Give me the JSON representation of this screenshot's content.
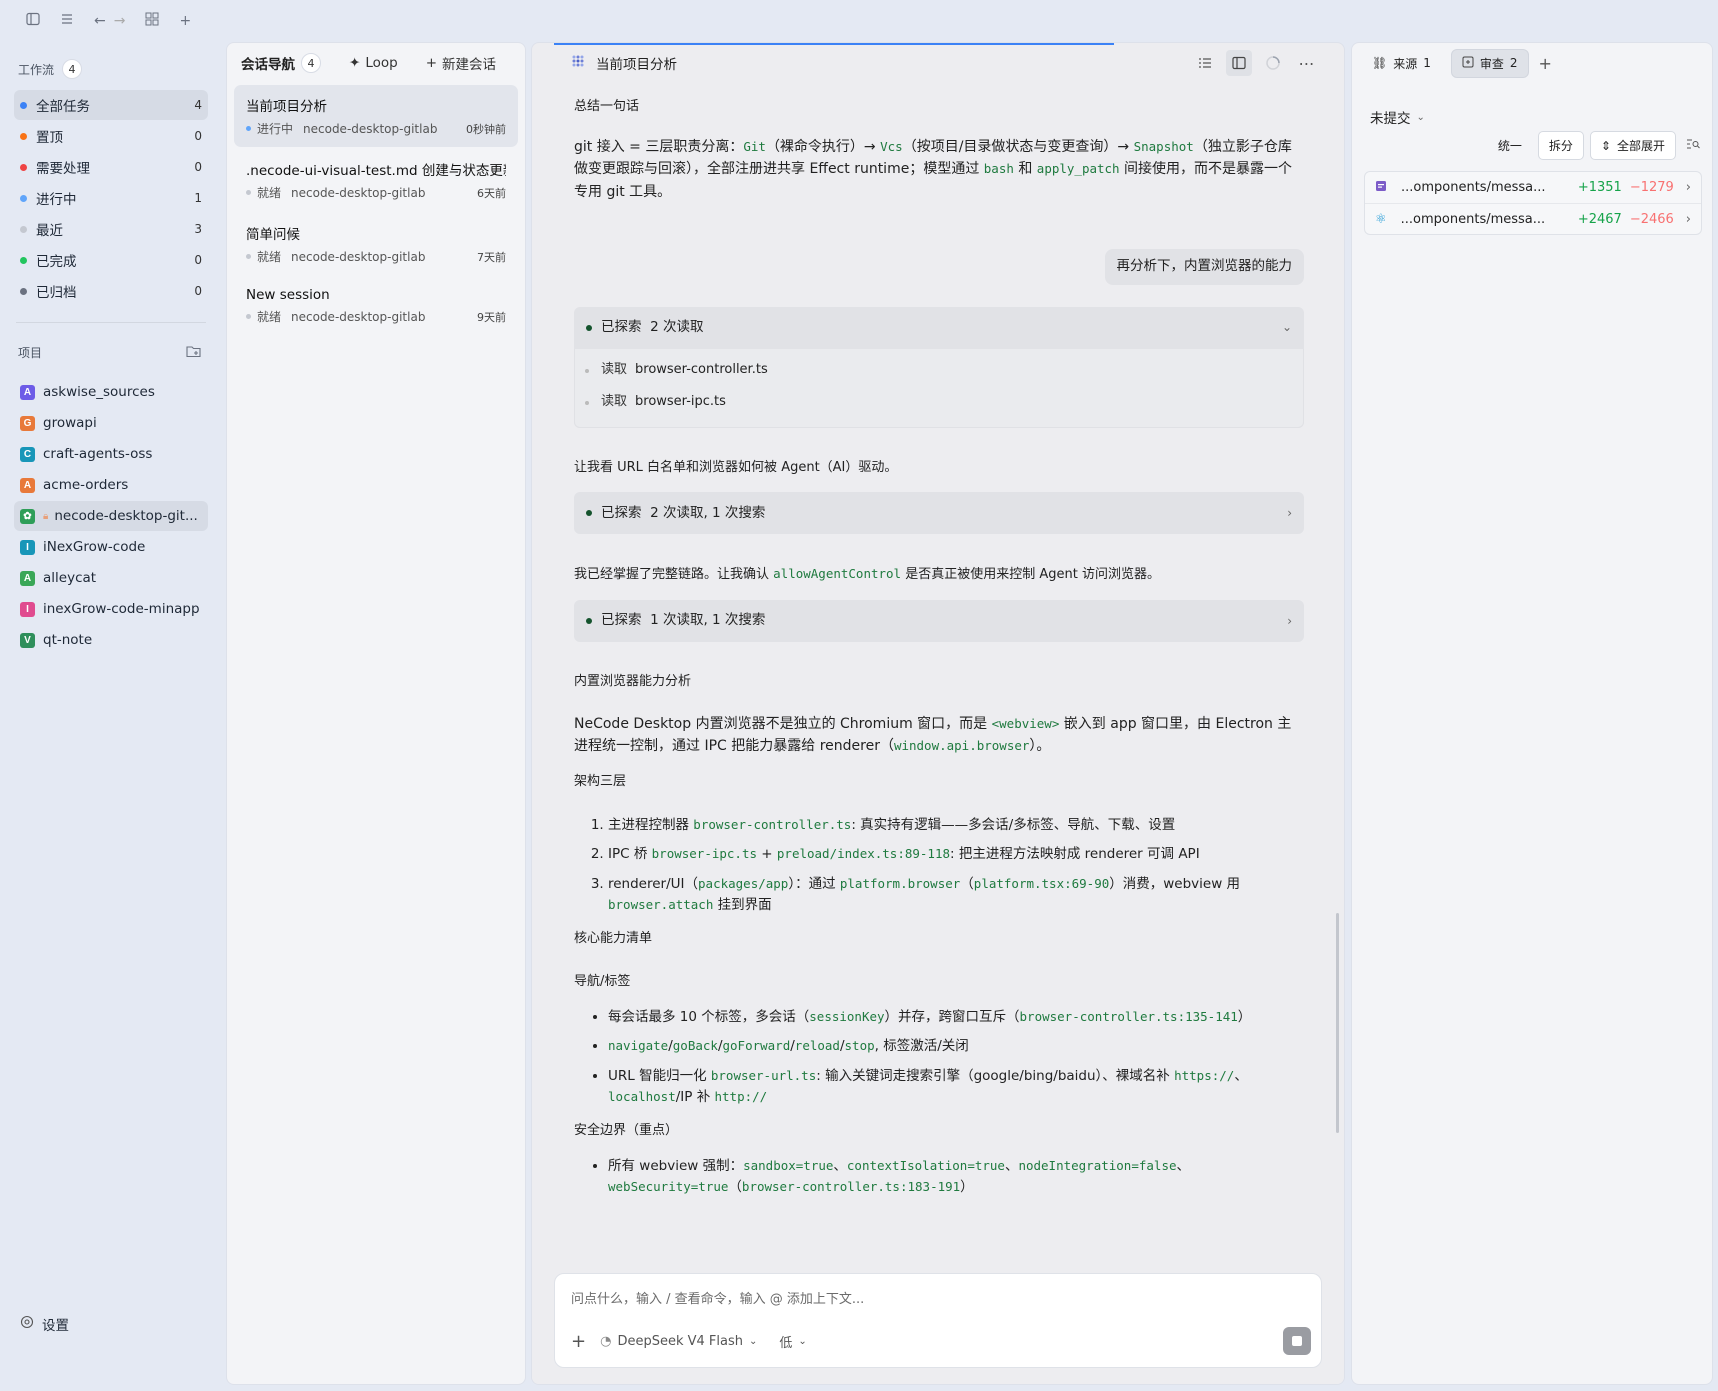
{
  "workflow": {
    "title": "工作流",
    "count": "4",
    "items": [
      {
        "label": "全部任务",
        "count": "4",
        "color": "#3b82f6"
      },
      {
        "label": "置顶",
        "count": "0",
        "color": "#f97316"
      },
      {
        "label": "需要处理",
        "count": "0",
        "color": "#ef4444"
      },
      {
        "label": "进行中",
        "count": "1",
        "color": "#60a5fa"
      },
      {
        "label": "最近",
        "count": "3",
        "color": "#c4c8d0"
      },
      {
        "label": "已完成",
        "count": "0",
        "color": "#22c55e"
      },
      {
        "label": "已归档",
        "count": "0",
        "color": "#6b7280"
      }
    ]
  },
  "projects": {
    "title": "项目",
    "items": [
      {
        "letter": "A",
        "label": "askwise_sources",
        "color": "#6d5ce7"
      },
      {
        "letter": "G",
        "label": "growapi",
        "color": "#e8793a"
      },
      {
        "letter": "C",
        "label": "craft-agents-oss",
        "color": "#1896b8"
      },
      {
        "letter": "A",
        "label": "acme-orders",
        "color": "#e8793a"
      },
      {
        "letter": "",
        "label": "necode-desktop-git...",
        "color": "#2f9e58"
      },
      {
        "letter": "I",
        "label": "iNexGrow-code",
        "color": "#1896b8"
      },
      {
        "letter": "A",
        "label": "alleycat",
        "color": "#3aa757"
      },
      {
        "letter": "I",
        "label": "inexGrow-code-minapp",
        "color": "#e04b8f"
      },
      {
        "letter": "V",
        "label": "qt-note",
        "color": "#2f8f5b"
      }
    ]
  },
  "settings_label": "设置",
  "sessions": {
    "title": "会话导航",
    "count": "4",
    "loop_label": "Loop",
    "new_label": "新建会话",
    "items": [
      {
        "name": "当前项目分析",
        "status": "进行中",
        "repo": "necode-desktop-gitlab",
        "time": "0秒钟前",
        "dot": "#60a5fa"
      },
      {
        "name": ".necode-ui-visual-test.md 创建与状态更新",
        "status": "就绪",
        "repo": "necode-desktop-gitlab",
        "time": "6天前",
        "dot": "#c4c8d0"
      },
      {
        "name": "简单问候",
        "status": "就绪",
        "repo": "necode-desktop-gitlab",
        "time": "7天前",
        "dot": "#c4c8d0"
      },
      {
        "name": "New session",
        "status": "就绪",
        "repo": "necode-desktop-gitlab",
        "time": "9天前",
        "dot": "#c4c8d0"
      }
    ]
  },
  "chat": {
    "title": "当前项目分析",
    "summary_heading": "总结一句话",
    "git_line": {
      "t1": "git 接入 = 三层职责分离：",
      "c1": "Git",
      "t2": "（裸命令执行）→ ",
      "c2": "Vcs",
      "t3": "（按项目/目录做状态与变更查询）→ ",
      "c3": "Snapshot",
      "t4": "（独立影子仓库做变更跟踪与回滚），全部注册进共享 Effect runtime；模型通过 ",
      "c4": "bash",
      "t5": " 和 ",
      "c5": "apply_patch",
      "t6": " 间接使用，而不是暴露一个专用 git 工具。"
    },
    "user_msg": "再分析下，内置浏览器的能力",
    "explore1": {
      "label": "已探索",
      "detail": "2 次读取",
      "rows": [
        {
          "verb": "读取",
          "file": "browser-controller.ts"
        },
        {
          "verb": "读取",
          "file": "browser-ipc.ts"
        }
      ]
    },
    "msg2": "让我看 URL 白名单和浏览器如何被 Agent（AI）驱动。",
    "explore2": {
      "label": "已探索",
      "detail": "2 次读取, 1 次搜索"
    },
    "msg3a": "我已经掌握了完整链路。让我确认 ",
    "msg3code": "allowAgentControl",
    "msg3b": " 是否真正被使用来控制 Agent 访问浏览器。",
    "explore3": {
      "label": "已探索",
      "detail": "1 次读取, 1 次搜索"
    },
    "section_heading": "内置浏览器能力分析",
    "intro": {
      "t1": "NeCode Desktop 内置浏览器不是独立的 Chromium 窗口，而是 ",
      "c1": "<webview>",
      "t2": " 嵌入到 app 窗口里，由 Electron 主进程统一控制，通过 IPC 把能力暴露给 renderer（",
      "c2": "window.api.browser",
      "t3": "）。"
    },
    "arch_heading": "架构三层",
    "arch": [
      {
        "t1": "主进程控制器 ",
        "c1": "browser-controller.ts",
        "t2": ": 真实持有逻辑——多会话/多标签、导航、下载、设置",
        "c2": "",
        "t3": "",
        "c3": "",
        "t4": "",
        "c4": "",
        "t5": ""
      },
      {
        "t1": "IPC 桥 ",
        "c1": "browser-ipc.ts",
        "t2": " + ",
        "c2": "preload/index.ts:89-118",
        "t3": ": 把主进程方法映射成 renderer 可调 API",
        "c3": "",
        "t4": "",
        "c4": "",
        "t5": ""
      },
      {
        "t1": "renderer/UI（",
        "c1": "packages/app",
        "t2": "）：通过 ",
        "c2": "platform.browser",
        "t3": "（",
        "c3": "platform.tsx:69-90",
        "t4": "）消费，webview 用 ",
        "c4": "browser.attach",
        "t5": " 挂到界面"
      }
    ],
    "core_heading": "核心能力清单",
    "nav_heading": "导航/标签",
    "nav": {
      "b1": {
        "t1": "每会话最多 10 个标签，多会话（",
        "c1": "sessionKey",
        "t2": "）并存，跨窗口互斥（",
        "c2": "browser-controller.ts:135-141",
        "t3": "）"
      },
      "b2": {
        "c1": "navigate",
        "s1": "/",
        "c2": "goBack",
        "s2": "/",
        "c3": "goForward",
        "s3": "/",
        "c4": "reload",
        "s4": "/",
        "c5": "stop",
        "t1": ", 标签激活/关闭"
      },
      "b3": {
        "t1": "URL 智能归一化 ",
        "c1": "browser-url.ts",
        "t2": ": 输入关键词走搜索引擎（google/bing/baidu）、裸域名补 ",
        "c2": "https://",
        "t3": "、",
        "c3": "localhost",
        "t4": "/IP 补 ",
        "c4": "http://"
      }
    },
    "security_heading": "安全边界（重点）",
    "sec": {
      "t1": "所有 webview 强制：",
      "c1": "sandbox=true",
      "s1": "、",
      "c2": "contextIsolation=true",
      "s2": "、",
      "c3": "nodeIntegration=false",
      "s3": "、",
      "c4": "webSecurity=true",
      "t2": "（",
      "c5": "browser-controller.ts:183-191",
      "t3": "）"
    },
    "composer_placeholder": "问点什么，输入 / 查看命令，输入 @ 添加上下文...",
    "model": "DeepSeek V4 Flash",
    "effort": "低"
  },
  "review": {
    "tab_source": "来源",
    "tab_source_count": "1",
    "tab_review": "审查",
    "tab_review_count": "2",
    "uncommitted": "未提交",
    "seg_unified": "统一",
    "seg_split": "拆分",
    "expand_all": "全部展开",
    "files": [
      {
        "name": "...omponents/messa...",
        "add": "+1351",
        "del": "−1279",
        "icon": "file-icon"
      },
      {
        "name": "...omponents/messa...",
        "add": "+2467",
        "del": "−2466",
        "icon": "react-icon"
      }
    ]
  }
}
